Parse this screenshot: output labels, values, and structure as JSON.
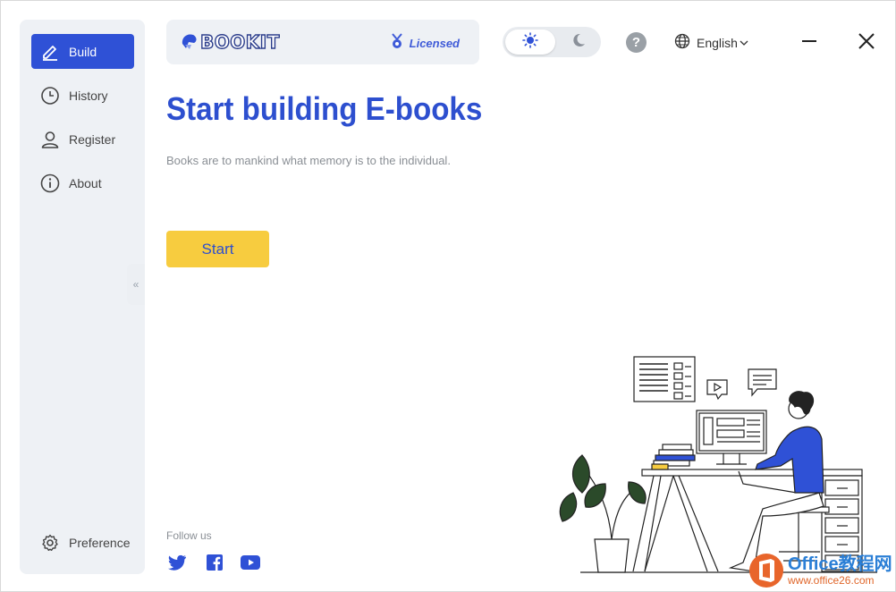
{
  "sidebar": {
    "items": [
      {
        "label": "Build",
        "icon": "pen-icon",
        "active": true
      },
      {
        "label": "History",
        "icon": "clock-icon"
      },
      {
        "label": "Register",
        "icon": "user-icon"
      },
      {
        "label": "About",
        "icon": "info-icon"
      }
    ],
    "preference": {
      "label": "Preference",
      "icon": "gear-icon"
    },
    "collapse_glyph": "«"
  },
  "header": {
    "brand": "BOOKIT",
    "license_status": "Licensed",
    "theme": {
      "selected": "light",
      "options": [
        "light",
        "dark"
      ]
    },
    "help_glyph": "?",
    "language": "English"
  },
  "main": {
    "title": "Start building E-books",
    "subtitle": "Books are to mankind what memory is to the individual.",
    "start_label": "Start",
    "follow_label": "Follow us",
    "social": [
      "twitter",
      "facebook",
      "youtube"
    ]
  },
  "watermark": {
    "title": "Office教程网",
    "url": "www.office26.com"
  },
  "colors": {
    "accent": "#2f51d6",
    "button": "#f7cc3f",
    "sidebar_bg": "#eef1f5"
  }
}
